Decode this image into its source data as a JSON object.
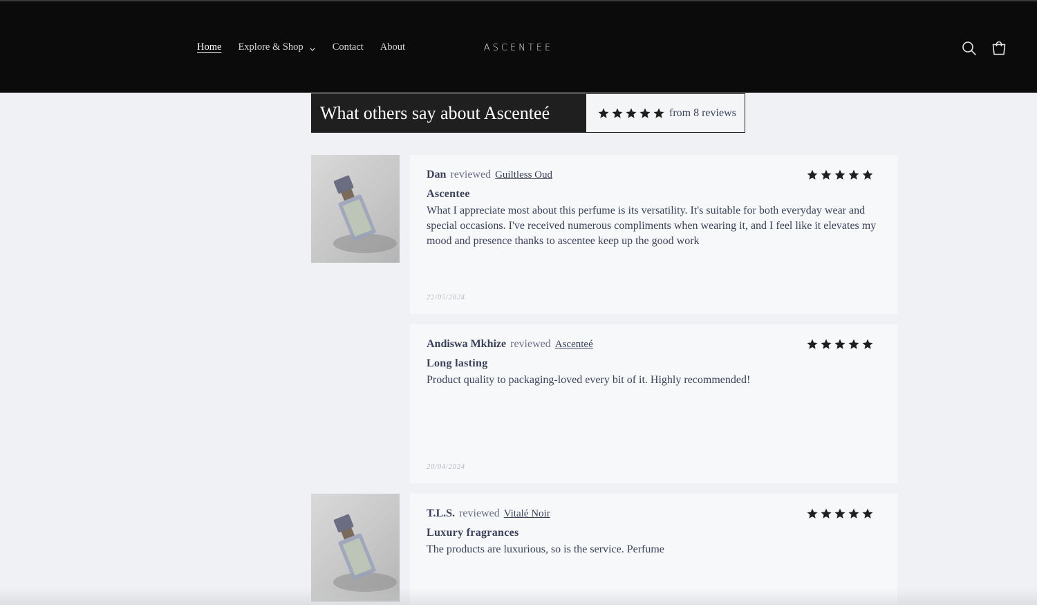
{
  "nav": {
    "items": [
      {
        "label": "Home",
        "active": true
      },
      {
        "label": "Explore & Shop",
        "dropdown": true
      },
      {
        "label": "Contact"
      },
      {
        "label": "About"
      }
    ]
  },
  "brand": {
    "logo_text": "ASCENTEE"
  },
  "header_icons": [
    "search-icon",
    "cart-icon"
  ],
  "summary": {
    "title": "What others say about Ascenteé",
    "rating": 5,
    "count_text": "from 8 reviews"
  },
  "reviews": [
    {
      "reviewer": "Dan",
      "reviewed_word": "reviewed",
      "product": "Guiltless Oud",
      "rating": 5,
      "title": "Ascentee",
      "body": "What I appreciate most about this perfume is its versatility. It's suitable for both everyday wear and special occasions. I've received numerous compliments when wearing it, and I feel like it elevates my mood and presence thanks to ascentee keep up the good work",
      "date": "22/05/2024",
      "has_image": true
    },
    {
      "reviewer": "Andiswa Mkhize",
      "reviewed_word": "reviewed",
      "product": "Ascenteé",
      "rating": 5,
      "title": "Long lasting",
      "body": "Product quality to packaging-loved every bit of it. Highly recommended!",
      "date": "20/04/2024",
      "has_image": false
    },
    {
      "reviewer": "T.L.S.",
      "reviewed_word": "reviewed",
      "product": "Vitalé Noir",
      "rating": 5,
      "title": "Luxury fragrances",
      "body": "The products are luxurious, so is the service. Perfume",
      "date": "",
      "has_image": true
    }
  ],
  "colors": {
    "header_bg": "#0b0b0c",
    "page_bg": "#f0f1f4",
    "card_bg": "#f7f8fa",
    "text": "#3a4159",
    "star": "#1f1f1f"
  }
}
